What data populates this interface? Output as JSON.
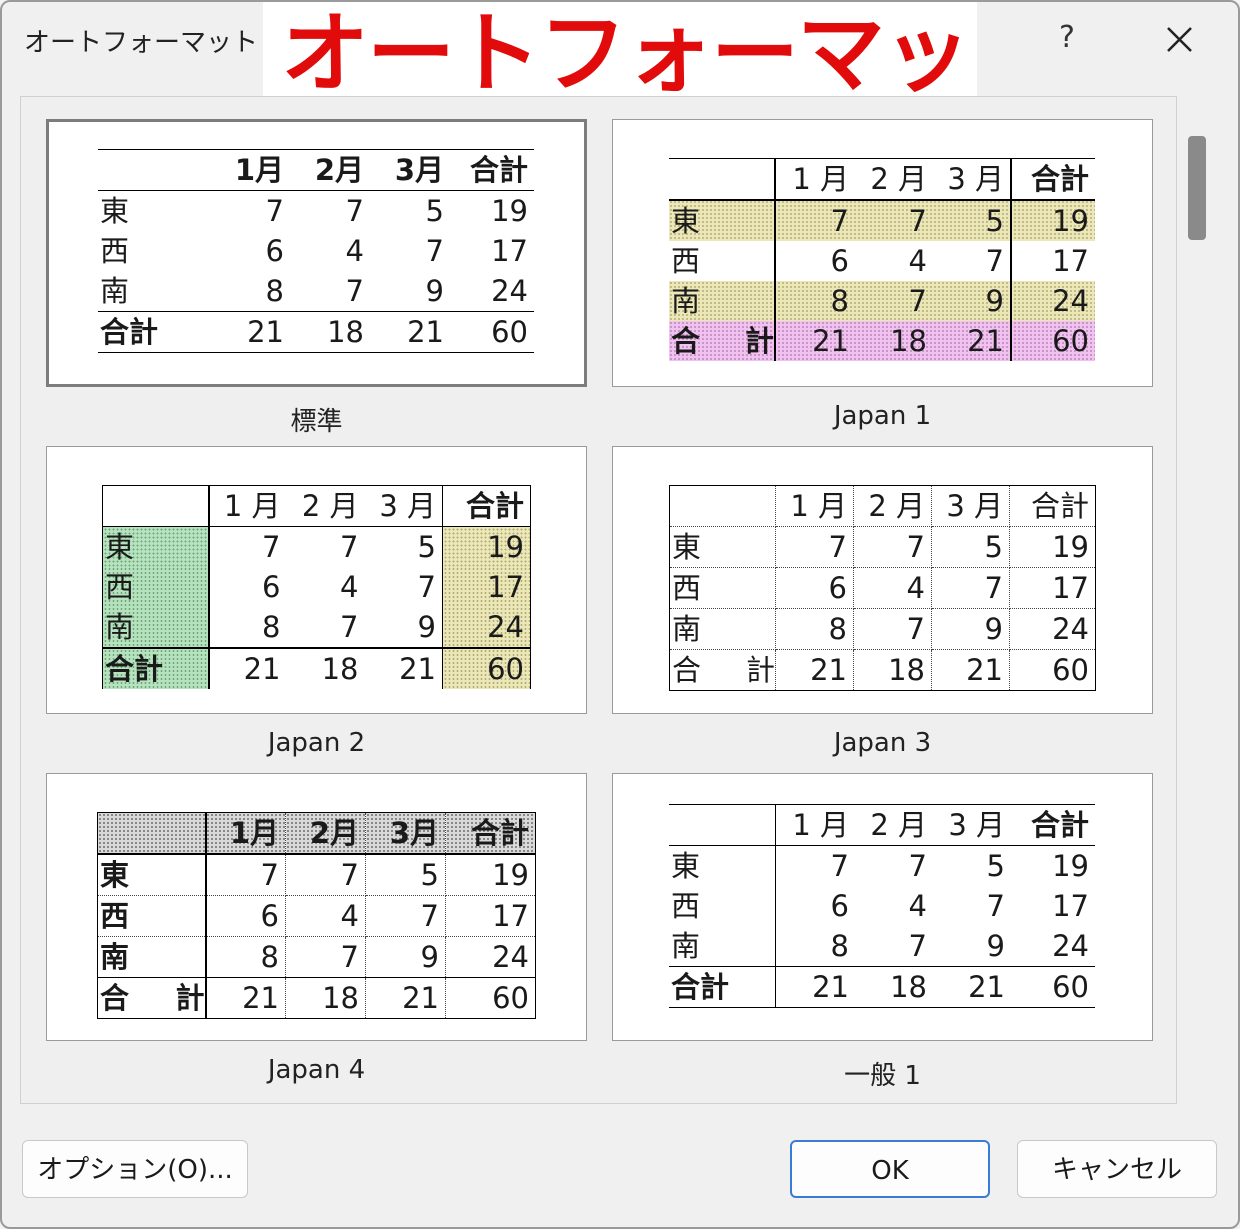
{
  "window": {
    "title": "オートフォーマット",
    "banner": "オートフォーマット"
  },
  "controls": {
    "help": "?"
  },
  "formats": [
    {
      "id": "std",
      "caption": "標準",
      "selected": true
    },
    {
      "id": "j1",
      "caption": "Japan 1",
      "selected": false
    },
    {
      "id": "j2",
      "caption": "Japan 2",
      "selected": false
    },
    {
      "id": "j3",
      "caption": "Japan 3",
      "selected": false
    },
    {
      "id": "j4",
      "caption": "Japan 4",
      "selected": false
    },
    {
      "id": "g1",
      "caption": "一般 1",
      "selected": false
    }
  ],
  "sample": {
    "headers": [
      "1月",
      "2月",
      "3月",
      "合計"
    ],
    "headers_spaced": [
      "1 月",
      "2 月",
      "3 月",
      "合計"
    ],
    "rows": [
      {
        "label": "東",
        "values": [
          "7",
          "7",
          "5",
          "19"
        ]
      },
      {
        "label": "西",
        "values": [
          "6",
          "4",
          "7",
          "17"
        ]
      },
      {
        "label": "南",
        "values": [
          "8",
          "7",
          "9",
          "24"
        ]
      }
    ],
    "total": {
      "label": "合計",
      "label_a": "合",
      "label_b": "計",
      "values": [
        "21",
        "18",
        "21",
        "60"
      ]
    }
  },
  "buttons": {
    "options": "オプション(O)...",
    "ok": "OK",
    "cancel": "キャンセル"
  },
  "colors": {
    "banner_text": "#e10b0b",
    "olive_fill": "#ebe7b8",
    "pink_fill": "#f1c2f0",
    "green_fill": "#b7e2bf"
  }
}
